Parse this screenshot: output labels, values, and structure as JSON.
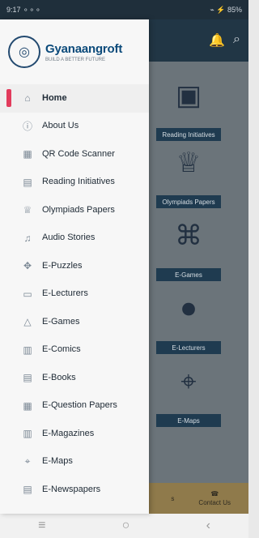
{
  "status": {
    "left_text": "9:17 ⚬⚬⚬",
    "right_text": "⌁ ⚡ 85%"
  },
  "header": {
    "icons": [
      "notification-icon",
      "search-icon"
    ]
  },
  "drawer": {
    "brand": {
      "badge_glyph": "◎",
      "name": "Gyanaangroft",
      "tagline": "BUILD A BETTER FUTURE"
    },
    "items": [
      {
        "label": "Home",
        "icon": "home-icon",
        "glyph": "⌂"
      },
      {
        "label": "About Us",
        "icon": "info-icon",
        "glyph": "ⓘ"
      },
      {
        "label": "QR Code Scanner",
        "icon": "qr-icon",
        "glyph": "▦"
      },
      {
        "label": "Reading Initiatives",
        "icon": "book-icon",
        "glyph": "▤"
      },
      {
        "label": "Olympiads Papers",
        "icon": "trophy-icon",
        "glyph": "♕"
      },
      {
        "label": "Audio Stories",
        "icon": "audio-icon",
        "glyph": "♫"
      },
      {
        "label": "E-Puzzles",
        "icon": "puzzle-icon",
        "glyph": "✥"
      },
      {
        "label": "E-Lecturers",
        "icon": "lecture-icon",
        "glyph": "▭"
      },
      {
        "label": "E-Games",
        "icon": "games-icon",
        "glyph": "△"
      },
      {
        "label": "E-Comics",
        "icon": "comics-icon",
        "glyph": "▥"
      },
      {
        "label": "E-Books",
        "icon": "books-icon",
        "glyph": "▤"
      },
      {
        "label": "E-Question Papers",
        "icon": "papers-icon",
        "glyph": "▦"
      },
      {
        "label": "E-Magazines",
        "icon": "magazine-icon",
        "glyph": "▥"
      },
      {
        "label": "E-Maps",
        "icon": "map-icon",
        "glyph": "⌖"
      },
      {
        "label": "E-Newspapers",
        "icon": "newspaper-icon",
        "glyph": "▤"
      }
    ]
  },
  "background": {
    "cards": [
      {
        "label": "Reading Initiatives",
        "icon": "book-icon",
        "glyph": "▣"
      },
      {
        "label": "Olympiads Papers",
        "icon": "trophy-icon",
        "glyph": "♕"
      },
      {
        "label": "E-Games",
        "icon": "gamepad-icon",
        "glyph": "⌘"
      },
      {
        "label": "E-Lecturers",
        "icon": "camera-icon",
        "glyph": "⏺"
      },
      {
        "label": "E-Maps",
        "icon": "map-icon",
        "glyph": "⌖"
      }
    ],
    "bottom_tabs": [
      {
        "label": "s"
      },
      {
        "label": "Contact Us"
      }
    ]
  },
  "navbar": {
    "items": [
      "≡",
      "○",
      "‹"
    ]
  },
  "colors": {
    "active_indicator": "#e23b5c",
    "brand_blue": "#0b4a7a",
    "appbar": "#213645"
  }
}
